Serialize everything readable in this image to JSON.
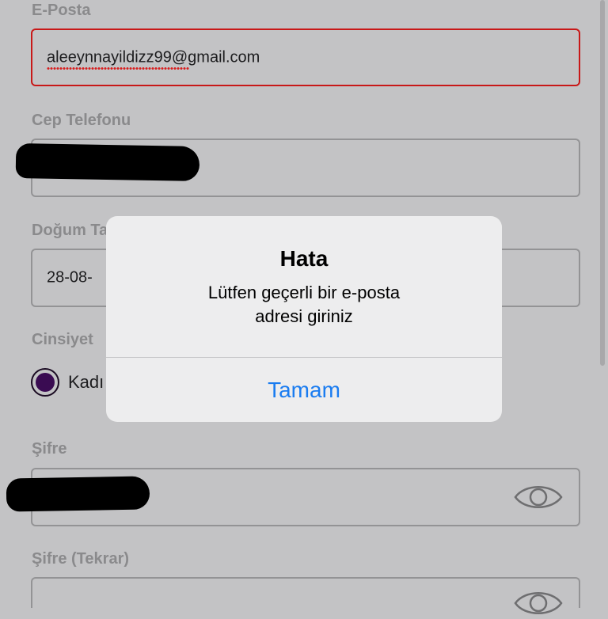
{
  "form": {
    "email": {
      "label": "E-Posta",
      "value": "aleeynnayildizz99@gmail.com"
    },
    "phone": {
      "label": "Cep Telefonu",
      "value": ""
    },
    "birthdate": {
      "label": "Doğum Ta",
      "value": "28-08-"
    },
    "gender": {
      "label": "Cinsiyet",
      "option_label": "Kadı"
    },
    "password": {
      "label": "Şifre",
      "value": ""
    },
    "password_repeat": {
      "label": "Şifre (Tekrar)",
      "value": ""
    }
  },
  "alert": {
    "title": "Hata",
    "message_line1": "Lütfen geçerli bir e-posta",
    "message_line2": "adresi giriniz",
    "button_label": "Tamam"
  },
  "icons": {
    "password_toggle": "eye-icon",
    "password_repeat_toggle": "eye-icon"
  },
  "colors": {
    "error_border": "#c81818",
    "radio_selected": "#3a0b52",
    "alert_button": "#1a7cf0"
  }
}
